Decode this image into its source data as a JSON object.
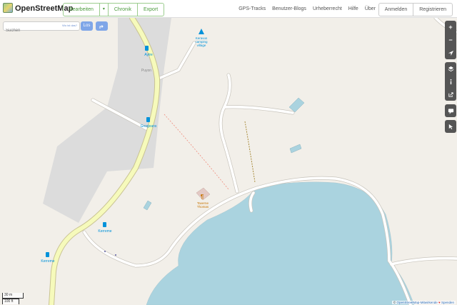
{
  "header": {
    "brand": "OpenStreetMap",
    "edit": "Bearbeiten",
    "edit_caret": "▾",
    "history": "Chronik",
    "export": "Export",
    "links": [
      "GPS-Tracks",
      "Benutzer-Blogs",
      "Urheberrecht",
      "Hilfe",
      "Über"
    ],
    "login": "Anmelden",
    "signup": "Registrieren"
  },
  "search": {
    "placeholder": "Suchen",
    "where_link": "Wo ist das?",
    "go_label": "Los",
    "directions_icon": "directions-icon"
  },
  "controls": {
    "zoom_in": "+",
    "zoom_out": "−",
    "icons": [
      "locate-icon",
      "layers-icon",
      "info-icon",
      "share-icon",
      "note-icon",
      "query-icon"
    ]
  },
  "map": {
    "colors": {
      "land": "#f2efe9",
      "grey_area": "#dcdcdc",
      "water": "#aad3df",
      "road_fill": "#f6fabb",
      "road_casing": "#c7c49a",
      "building": "#e3c9c4"
    },
    "labels": {
      "bus_stop_1": "Aytre",
      "bus_stop_2": "Grosjeans",
      "bus_stop_3": "Kerreme",
      "bus_stop_4": "Kerreme",
      "camping": [
        "Keravus",
        "camping",
        "village"
      ],
      "restaurant": [
        "Taverne",
        "Thomas"
      ],
      "minor_place": "Puyon"
    }
  },
  "scale": {
    "metric": "30 m",
    "imperial": "100 ft"
  },
  "attribution": {
    "prefix": "©",
    "link": "OpenStreetMap-Mitwirkende",
    "heart": "♥",
    "donate": "Spenden"
  }
}
